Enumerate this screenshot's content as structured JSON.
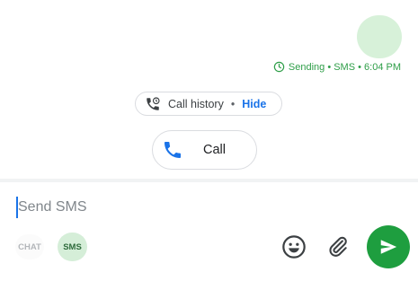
{
  "message": {
    "status_text": "Sending • SMS • 6:04 PM",
    "status_icon": "clock-icon",
    "accent": "#2e9e48",
    "bubble_color": "#d7f1d9"
  },
  "call_history": {
    "label": "Call history",
    "separator": "•",
    "hide_label": "Hide",
    "icon": "phone-history-icon"
  },
  "call_button": {
    "label": "Call",
    "icon": "phone-icon"
  },
  "compose": {
    "placeholder": "Send SMS",
    "chat_chip": "CHAT",
    "sms_chip": "SMS",
    "emoji_icon": "emoji-icon",
    "attach_icon": "paperclip-icon",
    "send_icon": "send-icon",
    "send_color": "#1e9e3f"
  }
}
